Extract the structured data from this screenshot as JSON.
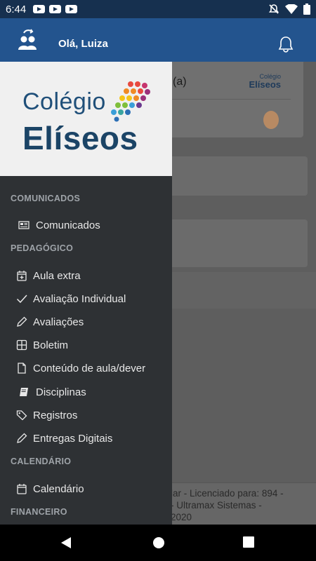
{
  "status_bar": {
    "time": "6:44",
    "notification_icons": [
      "youtube-icon",
      "youtube-icon",
      "youtube-icon"
    ],
    "system_icons": [
      "mute-icon",
      "wifi-icon",
      "battery-icon"
    ]
  },
  "app_bar": {
    "greeting": "Olá, Luiza",
    "left_icon": "user-group-icon",
    "right_icon": "bell-icon",
    "color": "#23548e"
  },
  "drawer": {
    "logo": {
      "line1": "Colégio",
      "line2": "Elíseos"
    },
    "sections": [
      {
        "title": "COMUNICADOS",
        "items": [
          {
            "label": "Comunicados",
            "icon": "newspaper-icon"
          }
        ]
      },
      {
        "title": "PEDAGÓGICO",
        "items": [
          {
            "label": "Aula extra",
            "icon": "calendar-plus-icon"
          },
          {
            "label": "Avaliação Individual",
            "icon": "check-icon"
          },
          {
            "label": "Avaliações",
            "icon": "pencil-icon"
          },
          {
            "label": "Boletim",
            "icon": "grid-icon"
          },
          {
            "label": "Conteúdo de aula/dever",
            "icon": "file-icon"
          },
          {
            "label": "Disciplinas",
            "icon": "book-icon"
          },
          {
            "label": "Registros",
            "icon": "tags-icon"
          },
          {
            "label": "Entregas Digitais",
            "icon": "pencil-icon"
          }
        ]
      },
      {
        "title": "CALENDÁRIO",
        "items": [
          {
            "label": "Calendário",
            "icon": "calendar-icon"
          }
        ]
      },
      {
        "title": "FINANCEIRO",
        "items": []
      }
    ]
  },
  "background": {
    "card_title": "(a)",
    "card_logo": {
      "line1": "Colégio",
      "line2": "Elíseos"
    },
    "footer_text": "...lar - Licenciado para: 894 - ... - Ultramax Sistemas - 2020"
  },
  "nav_bar": {
    "buttons": [
      "back-icon",
      "home-icon",
      "recents-icon"
    ]
  }
}
